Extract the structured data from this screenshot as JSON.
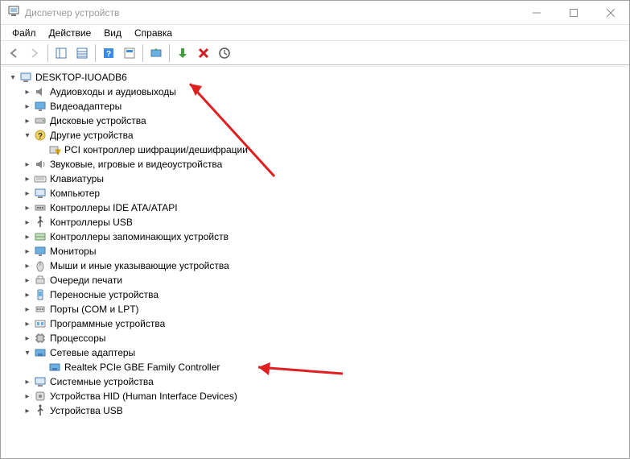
{
  "window": {
    "title": "Диспетчер устройств"
  },
  "menu": {
    "file": "Файл",
    "action": "Действие",
    "view": "Вид",
    "help": "Справка"
  },
  "tree": {
    "root": "DESKTOP-IUOADB6",
    "n0": "Аудиовходы и аудиовыходы",
    "n1": "Видеоадаптеры",
    "n2": "Дисковые устройства",
    "n3": "Другие устройства",
    "n3a": "PCI контроллер шифрации/дешифрации",
    "n4": "Звуковые, игровые и видеоустройства",
    "n5": "Клавиатуры",
    "n6": "Компьютер",
    "n7": "Контроллеры IDE ATA/ATAPI",
    "n8": "Контроллеры USB",
    "n9": "Контроллеры запоминающих устройств",
    "n10": "Мониторы",
    "n11": "Мыши и иные указывающие устройства",
    "n12": "Очереди печати",
    "n13": "Переносные устройства",
    "n14": "Порты (COM и LPT)",
    "n15": "Программные устройства",
    "n16": "Процессоры",
    "n17": "Сетевые адаптеры",
    "n17a": "Realtek PCIe GBE Family Controller",
    "n18": "Системные устройства",
    "n19": "Устройства HID (Human Interface Devices)",
    "n20": "Устройства USB"
  }
}
